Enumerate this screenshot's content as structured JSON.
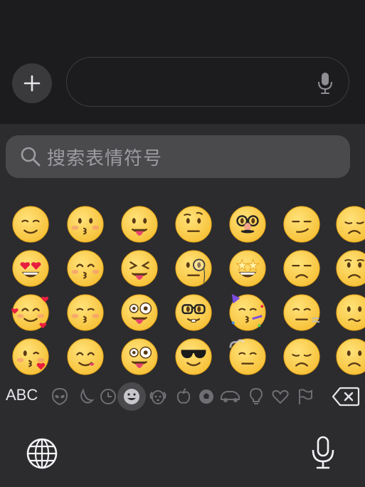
{
  "composer": {
    "add_button": "plus-icon",
    "message_mic": "microphone-icon"
  },
  "search": {
    "placeholder": "搜索表情符号",
    "icon": "search-icon"
  },
  "emoji_grid": {
    "columns": 7,
    "items": [
      "relieved-face",
      "kissing-face",
      "face-with-tongue",
      "face-with-raised-eyebrow",
      "disguised-face",
      "smirking-face",
      "pensive-face",
      "smiling-face-with-heart-eyes",
      "kissing-face-with-smiling-eyes",
      "squinting-face-with-tongue",
      "face-with-monocle",
      "star-struck",
      "unamused-face",
      "worried-face",
      "smiling-face-with-hearts",
      "kissing-face-with-closed-eyes",
      "winking-face-with-tongue",
      "nerd-face",
      "partying-face",
      "face-exhaling",
      "confused-face",
      "face-blowing-a-kiss",
      "face-savoring-food",
      "zany-face",
      "smiling-face-with-sunglasses",
      "face-in-clouds",
      "disappointed-face",
      "slightly-frowning-face"
    ]
  },
  "category_bar": {
    "abc_label": "ABC",
    "icons": [
      "alien-face-icon",
      "crescent-moon-icon",
      "clock-icon",
      "smiley-icon",
      "dog-face-icon",
      "apple-icon",
      "soccer-ball-icon",
      "car-icon",
      "lightbulb-icon",
      "heart-icon",
      "flag-icon"
    ],
    "selected": "smiley-icon",
    "delete": "delete-backspace-icon"
  },
  "bottom_bar": {
    "globe": "globe-icon",
    "dictation": "microphone-icon"
  },
  "colors": {
    "background": "#1c1c1e",
    "keyboard": "#2c2c2e",
    "search_field": "#4a4a4d",
    "emoji_yellow": "#f7c23a"
  }
}
